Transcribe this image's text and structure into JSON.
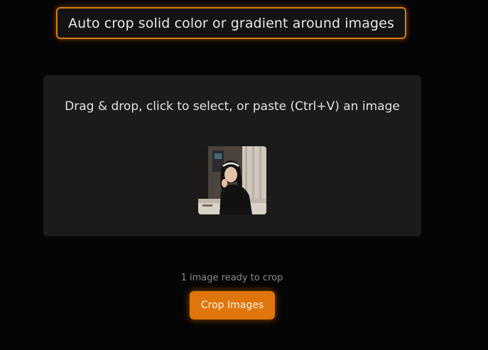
{
  "header": {
    "title": "Auto crop solid color or gradient around images"
  },
  "dropzone": {
    "instructions": "Drag & drop, click to select, or paste (Ctrl+V) an image",
    "thumbnail": {
      "alt": "image-thumbnail"
    }
  },
  "status": {
    "text": "1 image ready to crop"
  },
  "actions": {
    "crop_label": "Crop Images"
  },
  "colors": {
    "accent": "#df760b",
    "background": "#050505",
    "panel": "#1b1b1b"
  }
}
